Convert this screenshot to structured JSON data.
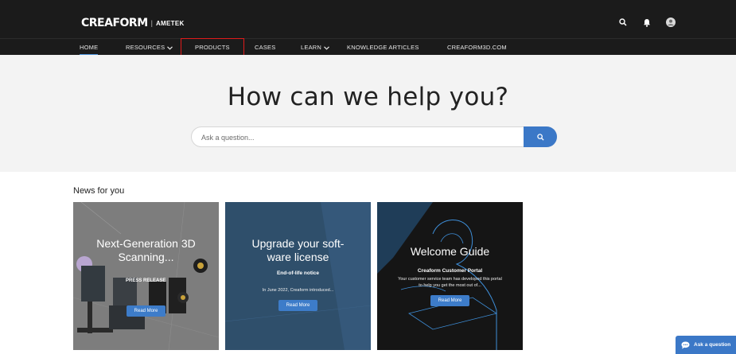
{
  "header": {
    "logo_main": "CREAFORM",
    "logo_sep": "|",
    "logo_sub": "AMETEK",
    "icons": [
      "search-icon",
      "bell-icon",
      "user-avatar-icon"
    ]
  },
  "nav": {
    "items": [
      {
        "label": "HOME",
        "active": true
      },
      {
        "label": "RESOURCES",
        "dropdown": true
      },
      {
        "label": "PRODUCTS",
        "highlighted": true
      },
      {
        "label": "CASES"
      },
      {
        "label": "LEARN",
        "dropdown": true
      },
      {
        "label": "KNOWLEDGE ARTICLES"
      },
      {
        "label": "CREAFORM3D.COM"
      }
    ]
  },
  "hero": {
    "title": "How can we help you?",
    "search_placeholder": "Ask a question..."
  },
  "news": {
    "title": "News for you",
    "cards": [
      {
        "heading": "Next-Generation 3D Scanning...",
        "tag": "PRESS RELEASE",
        "button": "Read More"
      },
      {
        "heading": "Upgrade your soft-ware license",
        "subheading": "End-of-life notice",
        "description": "In June 2022, Creaform introduced...",
        "button": "Read More"
      },
      {
        "heading": "Welcome Guide",
        "subheading": "Creaform Customer Portal",
        "description": "Your customer service team has developed this portal to help you get the most out of...",
        "button": "Read More"
      }
    ]
  },
  "chat": {
    "label": "Ask a question"
  },
  "colors": {
    "header_bg": "#1b1b1b",
    "accent": "#3b78c7",
    "highlight_outline": "#e01b1b",
    "hero_bg": "#f3f3f3"
  }
}
